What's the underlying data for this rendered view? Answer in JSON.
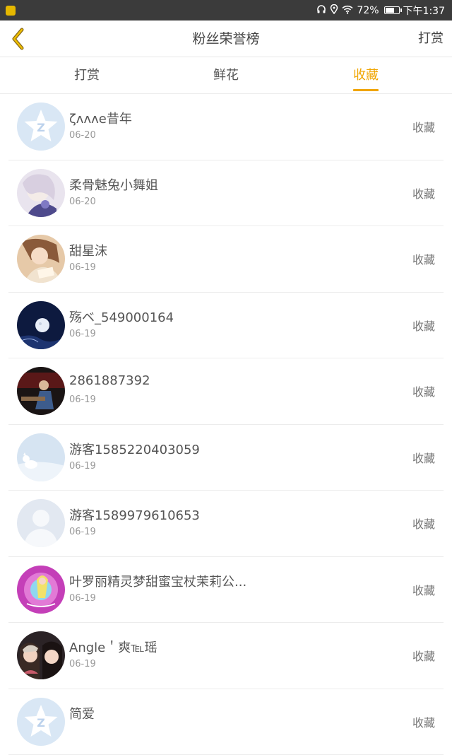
{
  "status_bar": {
    "battery": "72%",
    "battery_level": 0.72,
    "time": "下午1:37"
  },
  "navbar": {
    "title": "粉丝荣誉榜",
    "right_action": "打赏"
  },
  "tabs": [
    {
      "label": "打赏",
      "active": false
    },
    {
      "label": "鲜花",
      "active": false
    },
    {
      "label": "收藏",
      "active": true
    }
  ],
  "colors": {
    "accent": "#f0a500",
    "statusbar": "#3b3b3b"
  },
  "fans": [
    {
      "name": "ζʌʌʌe昔年",
      "date": "06-20",
      "action": "收藏",
      "avatar": "default-qq-star"
    },
    {
      "name": "柔骨魅兔小舞姐",
      "date": "06-20",
      "action": "收藏",
      "avatar": "anime-girl"
    },
    {
      "name": "甜星沫",
      "date": "06-19",
      "action": "收藏",
      "avatar": "anime-girl-reading"
    },
    {
      "name": "殇ベ_549000164",
      "date": "06-19",
      "action": "收藏",
      "avatar": "moon-night"
    },
    {
      "name": "2861887392",
      "date": "06-19",
      "action": "收藏",
      "avatar": "man-at-desk"
    },
    {
      "name": "游客1585220403059",
      "date": "06-19",
      "action": "收藏",
      "avatar": "white-fox"
    },
    {
      "name": "游客1589979610653",
      "date": "06-19",
      "action": "收藏",
      "avatar": "default-person"
    },
    {
      "name": "叶罗丽精灵梦甜蜜宝杖茉莉公...",
      "date": "06-19",
      "action": "收藏",
      "avatar": "pink-fairy"
    },
    {
      "name": "Angle＇爽℡瑶",
      "date": "06-19",
      "action": "收藏",
      "avatar": "two-girls-photo"
    },
    {
      "name": "简爱",
      "date": "",
      "action": "收藏",
      "avatar": "default-qq-star"
    }
  ]
}
